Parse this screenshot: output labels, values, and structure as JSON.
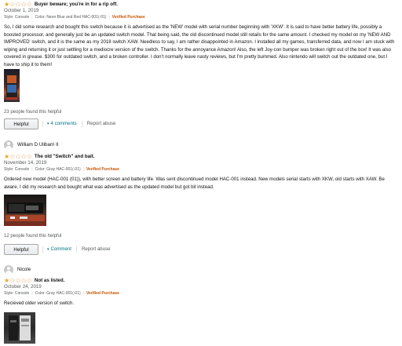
{
  "reviews": [
    {
      "rating": 1,
      "rating_max": 5,
      "title": "Buyer beware; you're in for a rip off.",
      "date": "October 1, 2019",
      "style": "Style: Console",
      "color": "Color: Neon Blue and Red HAC-001(-01)",
      "verified": "Verified Purchase",
      "body": "So, I did some research and bought this switch because it is advertised as the 'NEW' model with serial number beginning with 'XKW'. It is said to have better battery life, possibly a boosted processor, and generally just be an updated switch model. That being said, the old discontinued model still retails for the same amount. I checked my model on my 'NEW AND IMPROVED' switch, and it is the same as my 2018 switch XAW. Needless to say, I am rather disappointed in Amazon. I installed all my games, transferred data, and now I am stuck with wiping and returning it or just settling for a mediocre version of the switch. Thanks for the annoyance Amazon! Also, the left Joy-con bumper was broken right out of the box! It was also covered in grease. $300 for outdated switch, and a broken controller. I don't normally leave nasty reviews, but I'm pretty bummed. Also nintendo will switch out the outdated one, but I have to ship it to them!",
      "helpful_count": "23 people found this helpful",
      "helpful_label": "Helpful",
      "comments_label": "4 comments",
      "report_label": "Report abuse"
    },
    {
      "reviewer": "William D Ulibarri II",
      "rating": 1,
      "rating_max": 5,
      "title": "The old \"Switch\" and bait.",
      "date": "November 14, 2019",
      "style": "Style: Console",
      "color": "Color: Gray HAC-001(-01)",
      "verified": "Verified Purchase",
      "body": "Ordered new model (HAC-001 (01)), with better screen and battery life. Was sent discontinued model HAC-001 instead. New models serial starts with XKW, old starts with XAW. Be aware, I did my research and bought what was advertised as the updated model but got bit instead.",
      "helpful_count": "12 people found this helpful",
      "helpful_label": "Helpful",
      "comments_label": "Comment",
      "report_label": "Report abuse"
    },
    {
      "reviewer": "Nicole",
      "rating": 1,
      "rating_max": 5,
      "title": "Not as listed.",
      "date": "October 24, 2019",
      "style": "Style: Console",
      "color": "Color: Gray HAC-001(-01)",
      "verified": "Verified Purchase",
      "body": "Recieved older version of switch."
    }
  ],
  "icons": {
    "star_filled": "star-filled-icon",
    "star_empty": "star-empty-icon",
    "chevron": "chevron-down-icon"
  },
  "colors": {
    "star": "#f0a41a",
    "verified": "#c45500",
    "link": "#007185",
    "muted": "#565959"
  }
}
